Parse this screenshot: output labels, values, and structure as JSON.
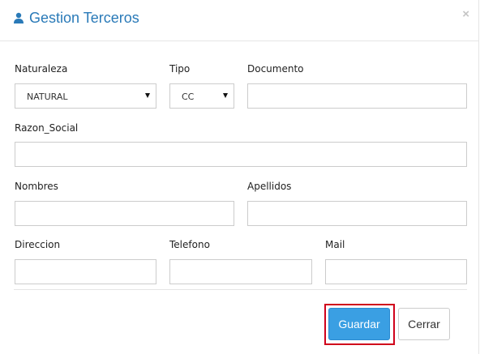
{
  "modal": {
    "title": "Gestion Terceros",
    "close_symbol": "×",
    "title_icon": "user-icon",
    "accent_color": "#2a7ab8"
  },
  "form": {
    "naturaleza": {
      "label": "Naturaleza",
      "selected": "NATURAL"
    },
    "tipo": {
      "label": "Tipo",
      "selected": "CC"
    },
    "documento": {
      "label": "Documento",
      "value": ""
    },
    "razon_social": {
      "label": "Razon_Social",
      "value": ""
    },
    "nombres": {
      "label": "Nombres",
      "value": ""
    },
    "apellidos": {
      "label": "Apellidos",
      "value": ""
    },
    "direccion": {
      "label": "Direccion",
      "value": ""
    },
    "telefono": {
      "label": "Telefono",
      "value": ""
    },
    "mail": {
      "label": "Mail",
      "value": ""
    }
  },
  "actions": {
    "save_label": "Guardar",
    "close_label": "Cerrar",
    "save_color": "#3a9fe3",
    "highlight_color": "#d0021b"
  }
}
